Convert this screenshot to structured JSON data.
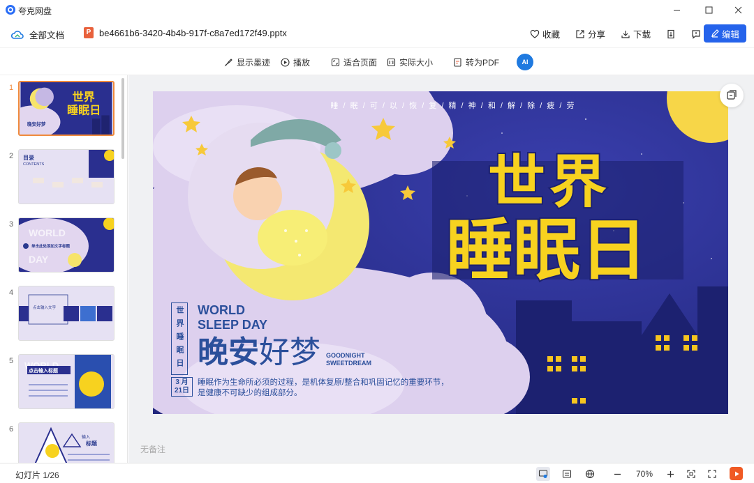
{
  "app": {
    "title": "夸克网盘"
  },
  "header": {
    "all_docs": "全部文档",
    "file_badge": "P",
    "file_name": "be4661b6-3420-4b4b-917f-c8a7ed172f49.pptx",
    "favorite": "收藏",
    "share": "分享",
    "download": "下载",
    "edit": "编辑"
  },
  "toolbar": {
    "show_ink": "显示墨迹",
    "play": "播放",
    "fit_page": "适合页面",
    "actual_size": "实际大小",
    "to_pdf": "转为PDF",
    "ai": "AI"
  },
  "thumbnails": [
    {
      "num": "1"
    },
    {
      "num": "2"
    },
    {
      "num": "3"
    },
    {
      "num": "4"
    },
    {
      "num": "5"
    },
    {
      "num": "6"
    }
  ],
  "slide": {
    "top_line": "睡 / 眠 / 可 / 以 / 恢 / 复 / 精 / 神 / 和 / 解 / 除 / 疲 / 劳",
    "big_title_1": "世界",
    "big_title_2": "睡眠日",
    "vertical_label": "世界睡眠日",
    "english_1": "WORLD",
    "english_2": "SLEEP DAY",
    "goodnight_a": "晚安",
    "goodnight_b": "好梦",
    "gn_en_1": "GOODNIGHT",
    "gn_en_2": "SWEETDREAM",
    "date_month": "3 月",
    "date_day": "21日",
    "desc_1": "睡眠作为生命所必须的过程，是机体复原/整合和巩固记忆的重要环节，",
    "desc_2": "是健康不可缺少的组成部分。"
  },
  "notes": "无备注",
  "status": {
    "slide_count": "幻灯片 1/26",
    "zoom": "70%"
  },
  "colors": {
    "accent": "#2563eb",
    "active_thumb": "#f08a3c",
    "slide_navy": "#2a2f8f",
    "slide_yellow": "#f7d21f"
  }
}
